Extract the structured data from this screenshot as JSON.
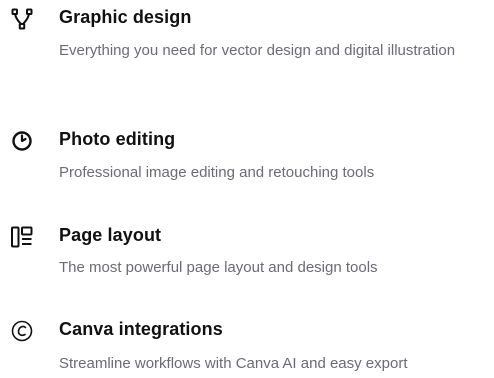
{
  "menu": {
    "items": [
      {
        "icon": "vector-nodes-icon",
        "title": "Graphic design",
        "description": "Everything you need for vector design and digital illustration"
      },
      {
        "icon": "photo-ring-icon",
        "title": "Photo editing",
        "description": "Professional image editing and retouching tools"
      },
      {
        "icon": "page-layout-icon",
        "title": "Page layout",
        "description": "The most powerful page layout and design tools"
      },
      {
        "icon": "canva-logo-icon",
        "title": "Canva integrations",
        "description": "Streamline workflows with Canva AI and easy export"
      }
    ]
  }
}
